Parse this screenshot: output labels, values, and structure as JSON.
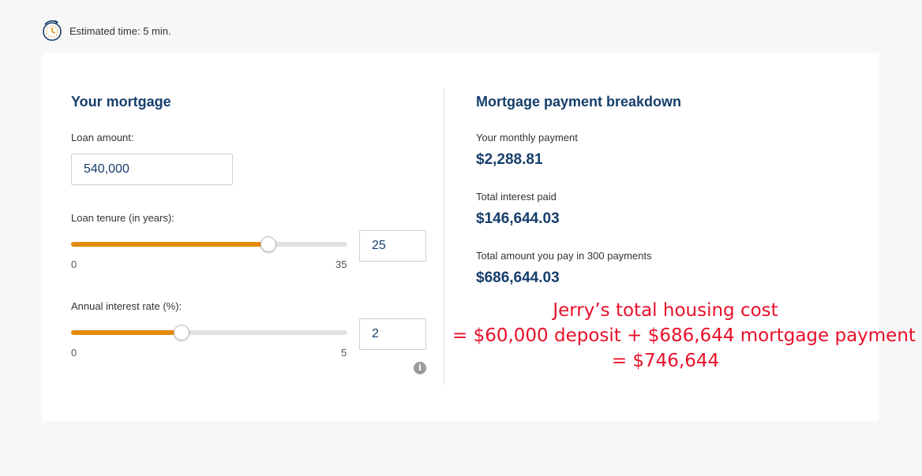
{
  "header": {
    "estimated_time": "Estimated time: 5 min.",
    "icon": "clock-icon"
  },
  "mortgage": {
    "title": "Your mortgage",
    "loan_amount_label": "Loan amount:",
    "loan_amount_value": "540,000",
    "tenure_label": "Loan tenure (in years):",
    "tenure_min": "0",
    "tenure_max": "35",
    "tenure_value": "25",
    "tenure_fraction": 0.714,
    "rate_label": "Annual interest rate (%):",
    "rate_min": "0",
    "rate_max": "5",
    "rate_value": "2",
    "rate_fraction": 0.4,
    "info_icon": "info-icon"
  },
  "breakdown": {
    "title": "Mortgage payment breakdown",
    "monthly_label": "Your monthly payment",
    "monthly_value": "$2,288.81",
    "interest_label": "Total interest paid",
    "interest_value": "$146,644.03",
    "total_label": "Total amount you pay in 300 payments",
    "total_value": "$686,644.03"
  },
  "annotation": {
    "line1": "Jerry’s total housing cost",
    "line2": "= $60,000 deposit + $686,644 mortgage payment",
    "line3": "= $746,644"
  },
  "colors": {
    "accent": "#e58a07",
    "heading": "#163e6b",
    "annotation": "#e8102a"
  }
}
